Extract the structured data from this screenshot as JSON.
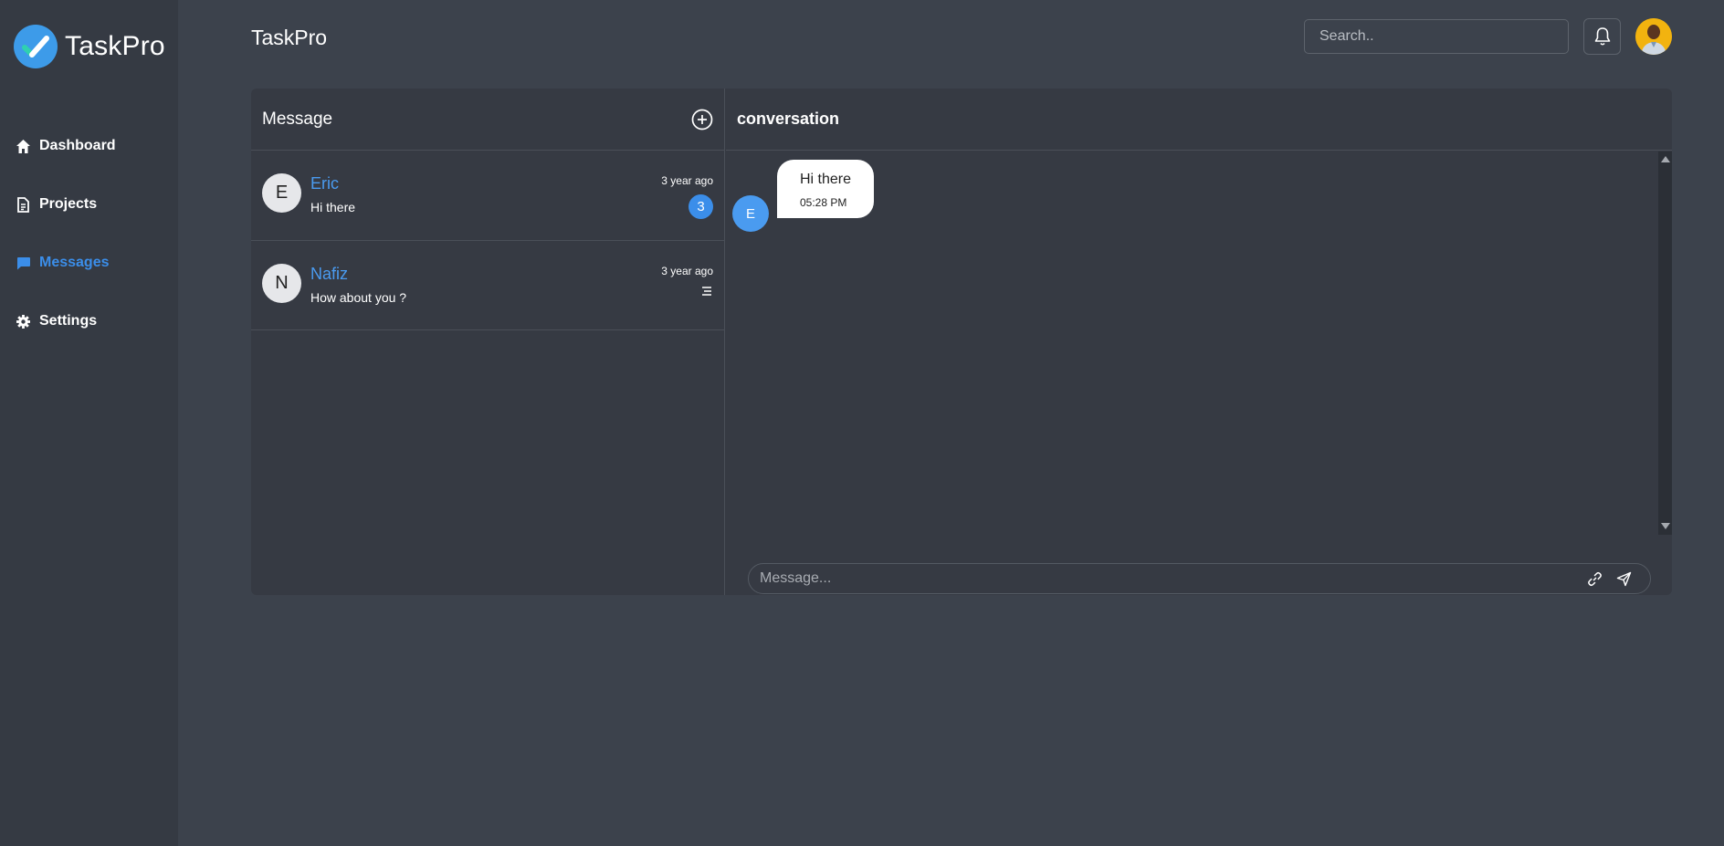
{
  "brand": {
    "name": "TaskPro",
    "logo_icon": "checkmark-logo-icon"
  },
  "sidebar": {
    "items": [
      {
        "label": "Dashboard",
        "icon": "home-icon",
        "active": false
      },
      {
        "label": "Projects",
        "icon": "document-icon",
        "active": false
      },
      {
        "label": "Messages",
        "icon": "chat-icon",
        "active": true
      },
      {
        "label": "Settings",
        "icon": "gear-icon",
        "active": false
      }
    ]
  },
  "header": {
    "title": "TaskPro",
    "search_placeholder": "Search..",
    "bell_icon": "bell-icon"
  },
  "messages_pane": {
    "title": "Message",
    "add_icon": "plus-circle-icon",
    "conversations": [
      {
        "initial": "E",
        "name": "Eric",
        "preview": "Hi there",
        "time": "3 year ago",
        "unread": "3"
      },
      {
        "initial": "N",
        "name": "Nafiz",
        "preview": "How about you ?",
        "time": "3 year ago",
        "status_icon": "read-lines-icon"
      }
    ]
  },
  "conversation_pane": {
    "title": "conversation",
    "messages": [
      {
        "sender_initial": "E",
        "text": "Hi there",
        "time": "05:28 PM"
      }
    ],
    "compose_placeholder": "Message...",
    "link_icon": "link-icon",
    "send_icon": "send-icon"
  },
  "colors": {
    "background": "#3c424c",
    "sidebar": "#353a43",
    "panel": "#363a43",
    "accent": "#3b8eea",
    "user_avatar": "#f2b30f"
  }
}
